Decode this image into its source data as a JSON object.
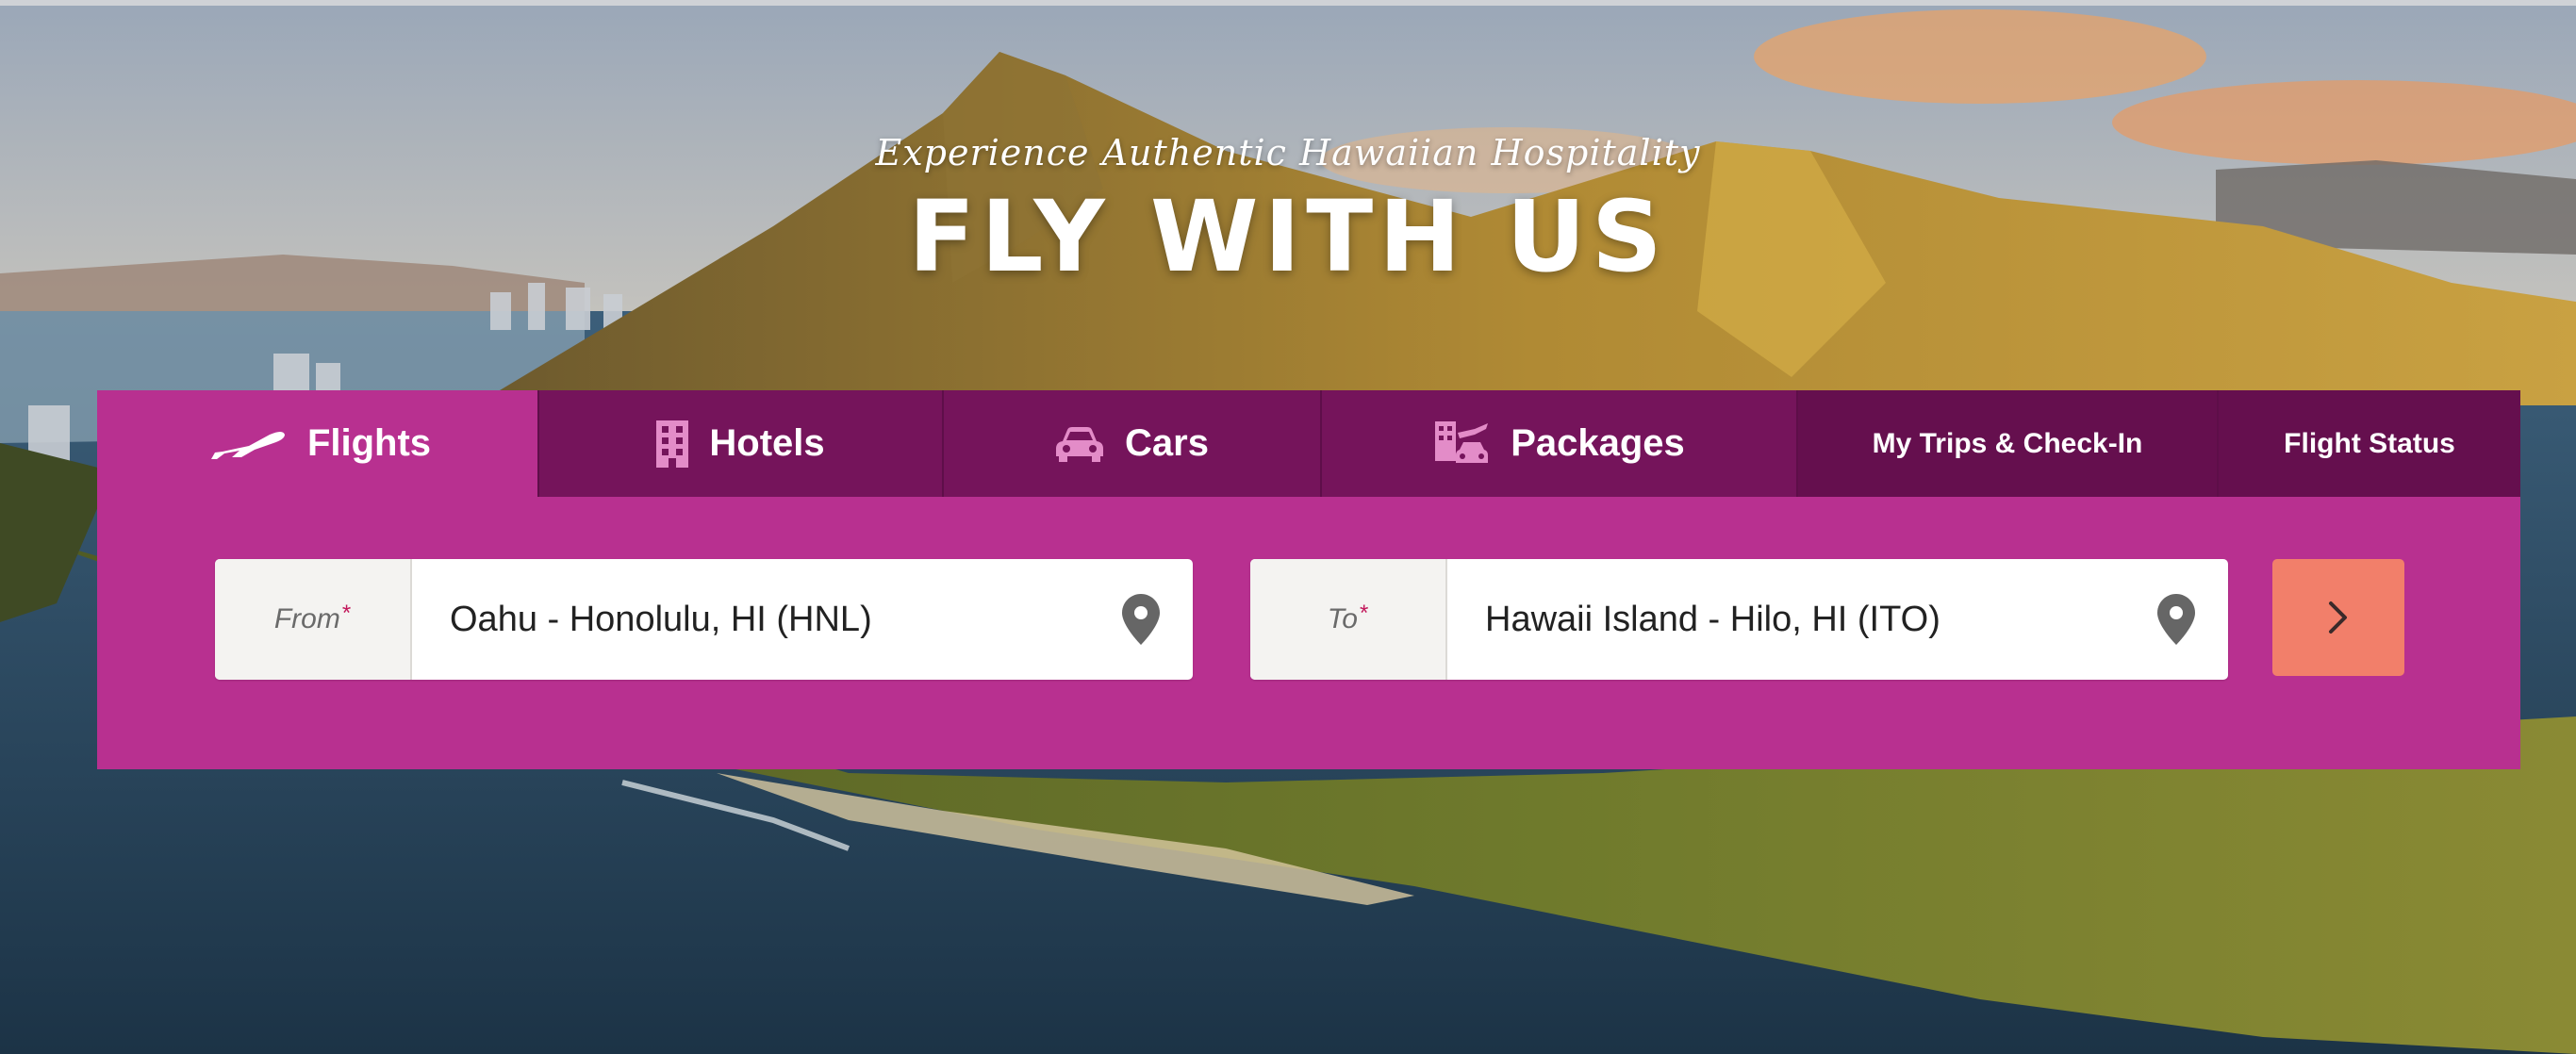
{
  "hero": {
    "tagline": "Experience Authentic Hawaiian Hospitality",
    "headline": "FLY WITH US"
  },
  "tabs": [
    {
      "label": "Flights",
      "icon": "plane-icon",
      "active": true
    },
    {
      "label": "Hotels",
      "icon": "building-icon",
      "active": false
    },
    {
      "label": "Cars",
      "icon": "car-icon",
      "active": false
    },
    {
      "label": "Packages",
      "icon": "package-icon",
      "active": false
    },
    {
      "label": "My Trips & Check-In",
      "active": false
    },
    {
      "label": "Flight Status",
      "active": false
    }
  ],
  "search": {
    "from_label": "From",
    "from_value": "Oahu - Honolulu, HI (HNL)",
    "to_label": "To",
    "to_value": "Hawaii Island - Hilo, HI (ITO)",
    "required_mark": "*",
    "submit_icon": "chevron-right-icon"
  },
  "colors": {
    "panel": "#b83090",
    "tab_inactive": "#75145b",
    "tab_secondary": "#650f4e",
    "submit": "#f27f6a",
    "pin": "#666666"
  }
}
